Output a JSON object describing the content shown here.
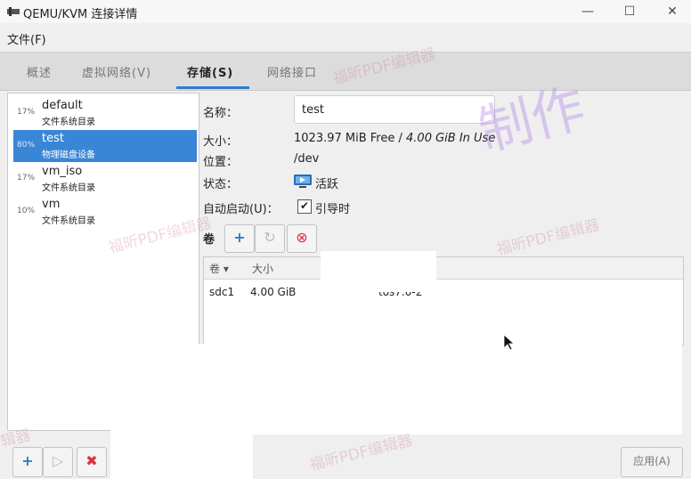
{
  "window": {
    "title": "QEMU/KVM 连接详情",
    "minimize": "—",
    "maximize": "☐",
    "close": "✕"
  },
  "menu": {
    "file": "文件(F)"
  },
  "tabs": [
    {
      "label": "概述"
    },
    {
      "label": "虚拟网络(V)"
    },
    {
      "label": "存储(S)"
    },
    {
      "label": "网络接口"
    }
  ],
  "pools": [
    {
      "pct": "17%",
      "name": "default",
      "type": "文件系统目录"
    },
    {
      "pct": "80%",
      "name": "test",
      "type": "物理磁盘设备"
    },
    {
      "pct": "17%",
      "name": "vm_iso",
      "type": "文件系统目录"
    },
    {
      "pct": "10%",
      "name": "vm",
      "type": "文件系统目录"
    }
  ],
  "details": {
    "name_label": "名称：",
    "name_value": "test",
    "size_label": "大小：",
    "size_free": "1023.97 MiB Free / ",
    "size_used": "4.00 GiB In Use",
    "location_label": "位置：",
    "location_value": "/dev",
    "state_label": "状态：",
    "state_value": "活跃",
    "autostart_label": "自动启动(U)：",
    "autostart_value": "引导时",
    "checkbox_mark": "✔"
  },
  "volumes": {
    "label": "卷",
    "columns": [
      "卷 ▾",
      "大小"
    ],
    "rows": [
      {
        "name": "sdc1",
        "size": "4.00 GiB",
        "extra": "tos7.0-2"
      }
    ],
    "toolbar": {
      "add": "+",
      "refresh": "↻",
      "delete": "⊗"
    }
  },
  "bottom": {
    "add": "+",
    "play": "▷",
    "delete": "✖",
    "apply": "应用(A)"
  },
  "watermarks": [
    "福昕PDF编辑器",
    "福昕PDF编辑器",
    "福昕PDF编辑器",
    "福昕PDF编辑器",
    "辑器"
  ],
  "watermark_big": "制作",
  "colors": {
    "accent": "#2e7bd1",
    "selected_row": "#3a86d6",
    "delete_red": "#d9333f"
  }
}
